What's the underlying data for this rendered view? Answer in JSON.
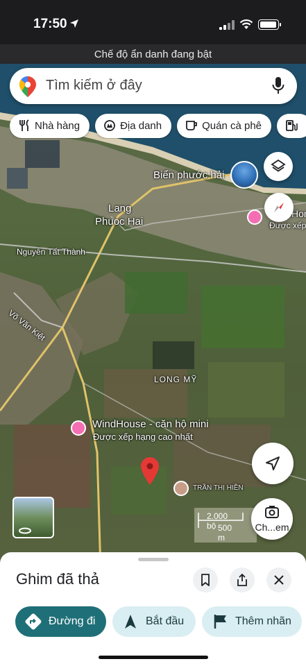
{
  "status": {
    "time": "17:50"
  },
  "incognito_banner": "Chế độ ẩn danh đang bật",
  "search": {
    "placeholder": "Tìm kiếm ở đây"
  },
  "chips": [
    {
      "label": "Nhà hàng",
      "icon": "fork-knife-icon"
    },
    {
      "label": "Địa danh",
      "icon": "landmark-icon"
    },
    {
      "label": "Quán cà phê",
      "icon": "coffee-icon"
    },
    {
      "label": "",
      "icon": "gas-station-icon"
    }
  ],
  "map": {
    "labels": {
      "beach": "Biển phước hải",
      "hotel_top": "Hor",
      "hotel_top_sub": "Được xếp",
      "town_line1": "Lang",
      "town_line2": "Phuoc Hai",
      "road1": "Nguyễn Tất Thành",
      "road2": "Võ Văn Kiệt",
      "area": "LONG MỸ",
      "hotel_name": "WindHouse - căn hộ mini",
      "hotel_rank": "Được xếp hạng cao nhất",
      "person": "TRẦN THỊ HIỀN",
      "scale_ft": "2.000 bộ",
      "scale_m": "500 m"
    },
    "camera_label": "Ch...em"
  },
  "sheet": {
    "title": "Ghim đã thả",
    "buttons": {
      "directions": "Đường đi",
      "start": "Bắt đầu",
      "add_label": "Thêm nhãn"
    }
  },
  "colors": {
    "primary_teal": "#1f6f78",
    "pill_light": "#d9eef2",
    "hotel_pink": "#f46eb3",
    "pin_red": "#e53935"
  }
}
